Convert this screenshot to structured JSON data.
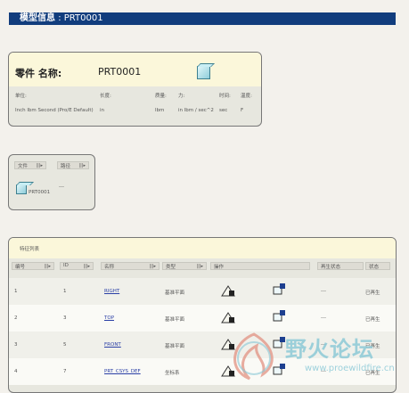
{
  "title_bar": {
    "label": "模型信息",
    "separator": ":",
    "model": "PRT0001"
  },
  "model_panel": {
    "part_label": "零件  名称:",
    "part_name": "PRT0001",
    "col_headers": [
      "单位:",
      "长度:",
      "质量:",
      "力:",
      "时间:",
      "温度:"
    ],
    "values": [
      "Inch lbm Second (Pro/E Default)",
      "in",
      "lbm",
      "in lbm / sec^2",
      "sec",
      "F"
    ]
  },
  "file_panel": {
    "headers": [
      "文件",
      "路径"
    ],
    "file_name": "PRT0001",
    "path": "---"
  },
  "feature_panel": {
    "title": "特征列表",
    "columns": [
      "编号",
      "ID",
      "名称",
      "类型",
      "操作",
      "",
      "",
      "再生状态"
    ],
    "rows": [
      {
        "num": "1",
        "id": "1",
        "name": "RIGHT",
        "type": "基准平面",
        "regen_order": "---",
        "status": "已再生"
      },
      {
        "num": "2",
        "id": "3",
        "name": "TOP",
        "type": "基准平面",
        "regen_order": "---",
        "status": "已再生"
      },
      {
        "num": "3",
        "id": "5",
        "name": "FRONT",
        "type": "基准平面",
        "regen_order": "---",
        "status": "已再生"
      },
      {
        "num": "4",
        "id": "7",
        "name": "PRT_CSYS_DEF",
        "type": "坐标系",
        "regen_order": "---",
        "status": "已再生"
      }
    ]
  },
  "watermark": {
    "text": "野火论坛",
    "url": "www.proewildfire.cn"
  },
  "colors": {
    "titlebar": "#113d7d",
    "panel_head": "#fbf7da",
    "link": "#2a3fa6"
  }
}
